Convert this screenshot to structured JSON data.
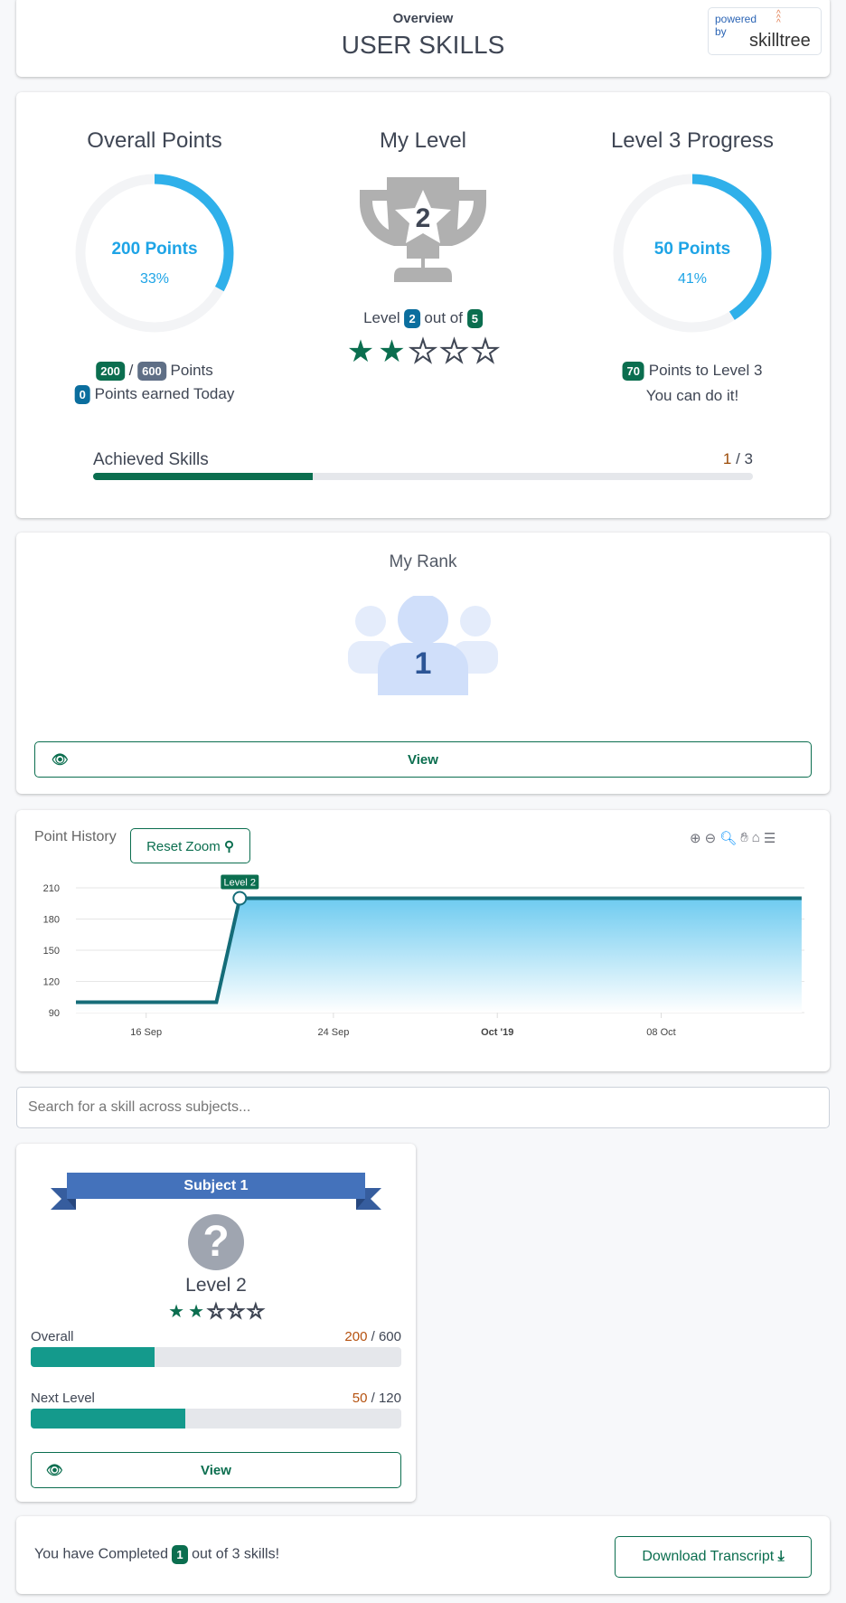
{
  "header": {
    "subtitle": "Overview",
    "title": "USER SKILLS",
    "logo": {
      "powered_by": "powered by",
      "brand": "skilltree"
    }
  },
  "overall": {
    "title": "Overall Points",
    "points_label": "200 Points",
    "percent_label": "33%",
    "percent": 33,
    "earned": "200",
    "total": "600",
    "points_word": "Points",
    "today": "0",
    "today_text": "Points earned Today"
  },
  "level": {
    "title": "My Level",
    "trophy_number": "2",
    "prefix": "Level",
    "current": "2",
    "out_of": "out of",
    "max": "5",
    "stars_filled": 2,
    "stars_total": 5
  },
  "progress": {
    "title": "Level 3 Progress",
    "points_label": "50 Points",
    "percent_label": "41%",
    "percent": 41,
    "remaining": "70",
    "remaining_text": "Points to Level 3",
    "encouragement": "You can do it!"
  },
  "achieved": {
    "label": "Achieved Skills",
    "done": "1",
    "sep": "/ 3",
    "percent": 33.3
  },
  "rank": {
    "title": "My Rank",
    "value": "1",
    "view_label": "View"
  },
  "history": {
    "title": "Point History",
    "reset_zoom": "Reset Zoom",
    "toolbar": [
      "zoom-in-icon",
      "zoom-out-icon",
      "selection-zoom-icon",
      "pan-icon",
      "home-icon",
      "menu-icon"
    ]
  },
  "chart_data": {
    "type": "area",
    "x": [
      "2019-09-13",
      "2019-09-19",
      "2019-09-20",
      "2019-10-14"
    ],
    "series": [
      {
        "values": [
          100,
          100,
          200,
          200
        ]
      }
    ],
    "ylim": [
      90,
      210
    ],
    "yticks": [
      "210",
      "180",
      "150",
      "120",
      "90"
    ],
    "xticks": [
      {
        "date": "2019-09-16",
        "label": "16 Sep"
      },
      {
        "date": "2019-09-24",
        "label": "24 Sep"
      },
      {
        "date": "2019-10-01",
        "label": "Oct '19"
      },
      {
        "date": "2019-10-08",
        "label": "08 Oct"
      }
    ],
    "annotations": [
      {
        "date": "2019-09-20",
        "value": 200,
        "label": "Level 2"
      }
    ],
    "grid": true,
    "colors": {
      "line": "#146c78",
      "fill": "#6ecbf0"
    }
  },
  "search": {
    "placeholder": "Search for a skill across subjects..."
  },
  "subject": {
    "name": "Subject 1",
    "level": "Level 2",
    "stars_filled": 2,
    "stars_total": 5,
    "overall_label": "Overall",
    "overall_earned": "200",
    "overall_total": "/ 600",
    "overall_percent": 33.3,
    "next_label": "Next Level",
    "next_earned": "50",
    "next_total": "/ 120",
    "next_percent": 41.7,
    "view_label": "View"
  },
  "footer": {
    "prefix": "You have Completed",
    "count": "1",
    "suffix": "out of 3 skills!",
    "download_label": "Download Transcript"
  }
}
